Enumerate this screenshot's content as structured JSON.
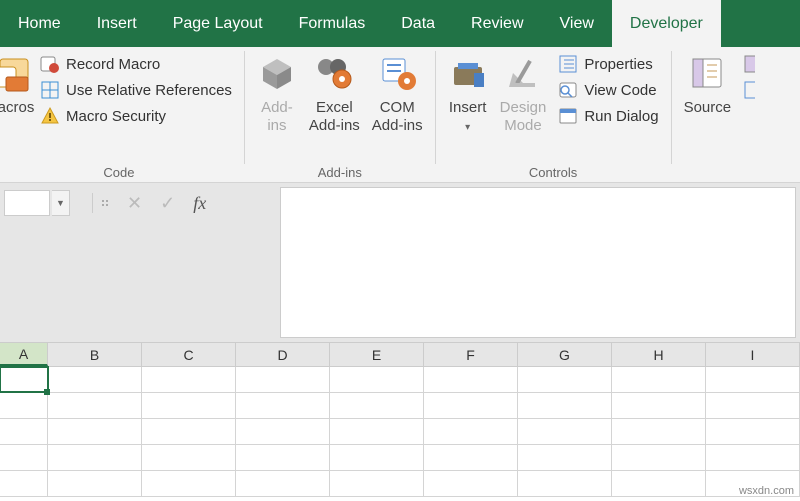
{
  "tabs": {
    "home": "Home",
    "insert": "Insert",
    "page_layout": "Page Layout",
    "formulas": "Formulas",
    "data": "Data",
    "review": "Review",
    "view": "View",
    "developer": "Developer"
  },
  "ribbon": {
    "code": {
      "label": "Code",
      "macros": "acros",
      "record_macro": "Record Macro",
      "use_relative": "Use Relative References",
      "macro_security": "Macro Security"
    },
    "addins": {
      "label": "Add-ins",
      "addins_btn_l1": "Add-",
      "addins_btn_l2": "ins",
      "excel_l1": "Excel",
      "excel_l2": "Add-ins",
      "com_l1": "COM",
      "com_l2": "Add-ins"
    },
    "controls": {
      "label": "Controls",
      "insert": "Insert",
      "design_l1": "Design",
      "design_l2": "Mode",
      "properties": "Properties",
      "view_code": "View Code",
      "run_dialog": "Run Dialog"
    },
    "xml": {
      "source": "Source"
    }
  },
  "formula_bar": {
    "fx": "fx",
    "cancel": "✕",
    "enter": "✓"
  },
  "grid": {
    "columns": [
      "A",
      "B",
      "C",
      "D",
      "E",
      "F",
      "G",
      "H",
      "I"
    ],
    "active_col": "A"
  },
  "watermark": "wsxdn.com"
}
